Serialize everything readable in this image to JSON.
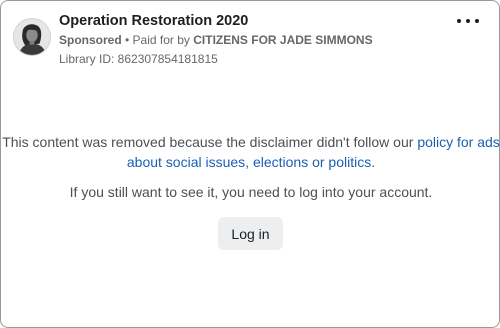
{
  "post": {
    "title": "Operation Restoration 2020",
    "sponsored_label": "Sponsored",
    "paid_for_prefix": " • Paid for by ",
    "payer": "CITIZENS FOR JADE SIMMONS",
    "library_id": "Library ID: 862307854181815",
    "avatar_icon": "profile-photo",
    "more_icon": "more-options-icon"
  },
  "notice": {
    "removed_text_before": "This content was removed because the disclaimer didn't follow our ",
    "policy_link": "policy for ads about social issues, elections or politics",
    "removed_text_after": ".",
    "login_hint": "If you still want to see it, you need to log into your account.",
    "login_button": "Log in"
  },
  "colors": {
    "link": "#1a5fb4",
    "button_bg": "#eceef0",
    "muted_text": "#65676b"
  }
}
